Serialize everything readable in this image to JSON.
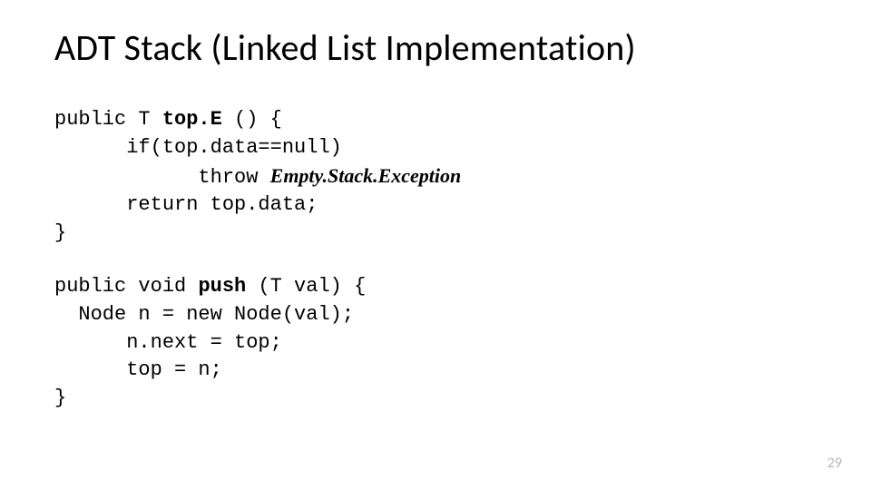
{
  "title": "ADT Stack (Linked List Implementation)",
  "block1": {
    "l1a": "public T ",
    "l1b": "top.E",
    "l1c": " () {",
    "l2": "      if(top.data==null)",
    "l3a": "            throw ",
    "l3b": "Empty.Stack.Exception",
    "l4": "      return top.data;",
    "l5": "}"
  },
  "block2": {
    "l1a": "public void ",
    "l1b": "push",
    "l1c": " (T val) {",
    "l2": "  Node n = new Node(val);",
    "l3": "      n.next = top;",
    "l4": "      top = n;",
    "l5": "}"
  },
  "page": "29"
}
